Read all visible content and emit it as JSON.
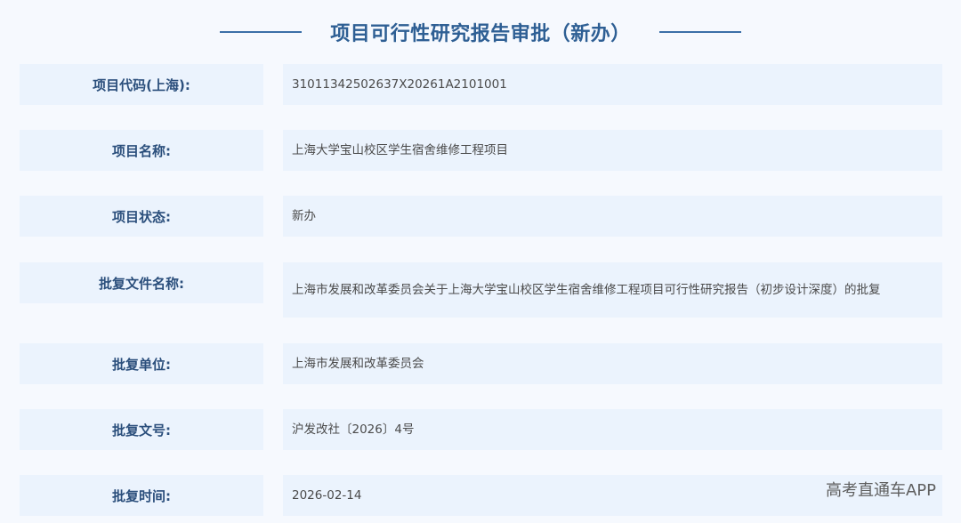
{
  "title": "项目可行性研究报告审批（新办）",
  "rows": [
    {
      "label": "项目代码(上海):",
      "value": "31011342502637X20261A2101001"
    },
    {
      "label": "项目名称:",
      "value": "上海大学宝山校区学生宿舍维修工程项目"
    },
    {
      "label": "项目状态:",
      "value": "新办"
    },
    {
      "label": "批复文件名称:",
      "value": "上海市发展和改革委员会关于上海大学宝山校区学生宿舍维修工程项目可行性研究报告（初步设计深度）的批复"
    },
    {
      "label": "批复单位:",
      "value": "上海市发展和改革委员会"
    },
    {
      "label": "批复文号:",
      "value": "沪发改社〔2026〕4号"
    },
    {
      "label": "批复时间:",
      "value": "2026-02-14"
    }
  ],
  "watermark": "高考直通车APP",
  "colors": {
    "accent": "#2e5f94",
    "cell_bg": "#ebf3fd",
    "page_bg": "#f6f9fe"
  }
}
